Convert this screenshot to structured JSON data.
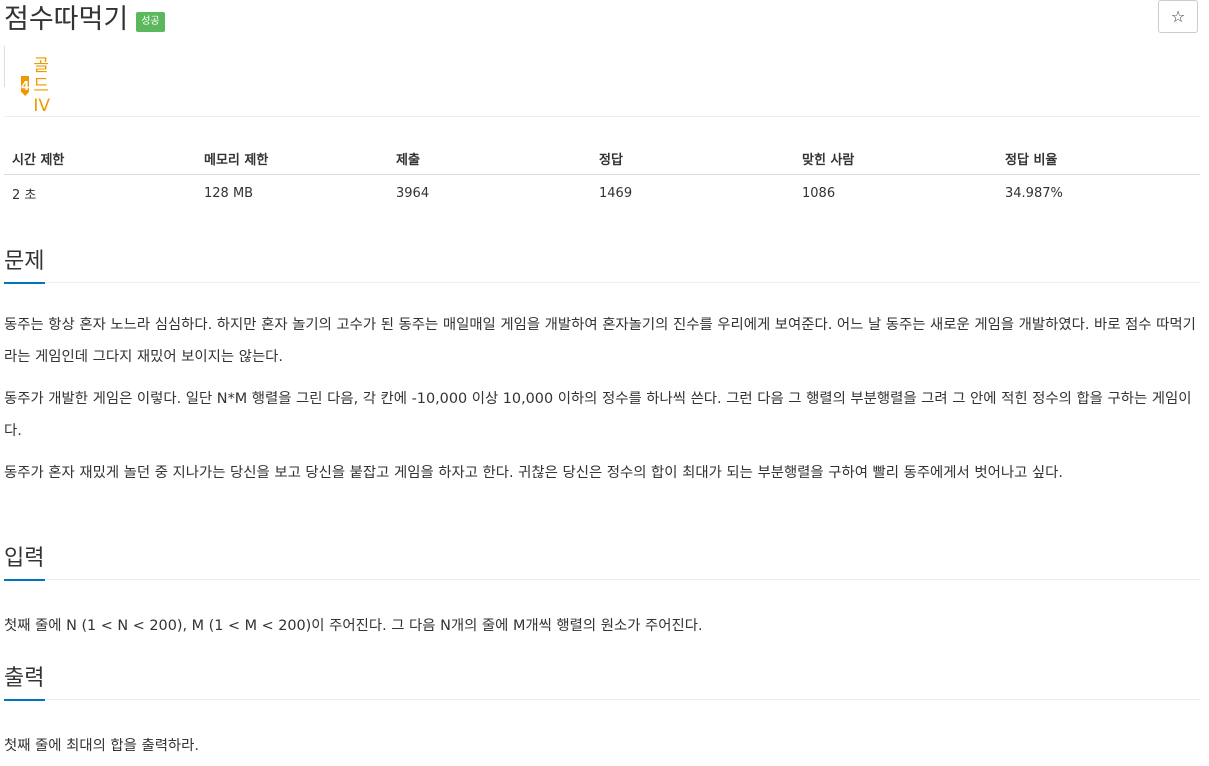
{
  "title": "점수따먹기",
  "status_badge": "성공",
  "star_symbol": "☆",
  "tier": {
    "level": "4",
    "label": "골드 IV",
    "color": "#ec9a00"
  },
  "info_table": {
    "headers": [
      "시간 제한",
      "메모리 제한",
      "제출",
      "정답",
      "맞힌 사람",
      "정답 비율"
    ],
    "values": [
      "2 초",
      "128 MB",
      "3964",
      "1469",
      "1086",
      "34.987%"
    ]
  },
  "problem": {
    "heading": "문제",
    "paragraphs": [
      "동주는 항상 혼자 노느라 심심하다. 하지만 혼자 놀기의 고수가 된 동주는 매일매일 게임을 개발하여 혼자놀기의 진수를 우리에게 보여준다. 어느 날 동주는 새로운 게임을 개발하였다. 바로 점수 따먹기라는 게임인데 그다지 재밌어 보이지는 않는다.",
      "동주가 개발한 게임은 이렇다. 일단 N*M 행렬을 그린 다음, 각 칸에 -10,000 이상 10,000 이하의 정수를 하나씩 쓴다. 그런 다음 그 행렬의 부분행렬을 그려 그 안에 적힌 정수의 합을 구하는 게임이다.",
      "동주가 혼자 재밌게 놀던 중 지나가는 당신을 보고 당신을 붙잡고 게임을 하자고 한다. 귀찮은 당신은 정수의 합이 최대가 되는 부분행렬을 구하여 빨리 동주에게서 벗어나고 싶다."
    ]
  },
  "input": {
    "heading": "입력",
    "text": "첫째 줄에 N (1 < N < 200), M (1 < M < 200)이 주어진다. 그 다음 N개의 줄에 M개씩 행렬의 원소가 주어진다."
  },
  "output": {
    "heading": "출력",
    "text": "첫째 줄에 최대의 합을 출력하라."
  },
  "colors": {
    "accent": "#0076c0",
    "success": "#5cb85c"
  }
}
